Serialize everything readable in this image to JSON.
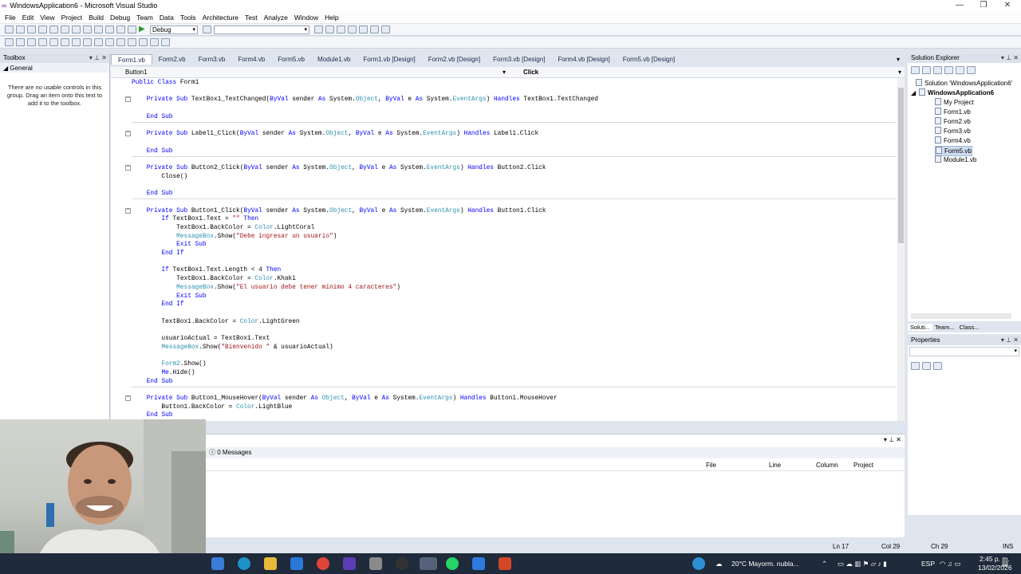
{
  "window": {
    "title": "WindowsApplication6 - Microsoft Visual Studio",
    "minimize": "—",
    "maximize": "❐",
    "close": "✕"
  },
  "menu": [
    "File",
    "Edit",
    "View",
    "Project",
    "Build",
    "Debug",
    "Team",
    "Data",
    "Tools",
    "Architecture",
    "Test",
    "Analyze",
    "Window",
    "Help"
  ],
  "toolbar": {
    "config": "Debug",
    "platform": ""
  },
  "toolbox": {
    "title": "Toolbox",
    "group": "General",
    "empty_message": "There are no usable controls in this group. Drag an item onto this text to add it to the toolbox."
  },
  "editor": {
    "tabs": [
      "Form1.vb",
      "Form2.vb",
      "Form3.vb",
      "Form4.vb",
      "Form5.vb",
      "Module1.vb",
      "Form1.vb [Design]",
      "Form2.vb [Design]",
      "Form3.vb [Design]",
      "Form4.vb [Design]",
      "Form5.vb [Design]"
    ],
    "active_tab": 0,
    "object_dropdown": "Button1",
    "event_dropdown": "Click",
    "lines": [
      "Public Class Form1",
      "",
      "    Private Sub TextBox1_TextChanged(ByVal sender As System.Object, ByVal e As System.EventArgs) Handles TextBox1.TextChanged",
      "",
      "    End Sub",
      "",
      "    Private Sub Label1_Click(ByVal sender As System.Object, ByVal e As System.EventArgs) Handles Label1.Click",
      "",
      "    End Sub",
      "",
      "    Private Sub Button2_Click(ByVal sender As System.Object, ByVal e As System.EventArgs) Handles Button2.Click",
      "        Close()",
      "",
      "    End Sub",
      "",
      "    Private Sub Button1_Click(ByVal sender As System.Object, ByVal e As System.EventArgs) Handles Button1.Click",
      "        If TextBox1.Text = \"\" Then",
      "            TextBox1.BackColor = Color.LightCoral",
      "            MessageBox.Show(\"Debe ingresar un usuario\")",
      "            Exit Sub",
      "        End If",
      "",
      "        If TextBox1.Text.Length < 4 Then",
      "            TextBox1.BackColor = Color.Khaki",
      "            MessageBox.Show(\"El usuario debe tener mínimo 4 caracteres\")",
      "            Exit Sub",
      "        End If",
      "",
      "        TextBox1.BackColor = Color.LightGreen",
      "",
      "        usuarioActual = TextBox1.Text",
      "        MessageBox.Show(\"Bienvenido \" & usuarioActual)",
      "",
      "        Form2.Show()",
      "        Me.Hide()",
      "    End Sub",
      "",
      "    Private Sub Button1_MouseHover(ByVal sender As Object, ByVal e As System.EventArgs) Handles Button1.MouseHover",
      "        Button1.BackColor = Color.LightBlue",
      "    End Sub"
    ]
  },
  "solution_explorer": {
    "title": "Solution Explorer",
    "solution": "Solution 'WindowsApplication6'",
    "project": "WindowsApplication6",
    "items": [
      "My Project",
      "Form1.vb",
      "Form2.vb",
      "Form3.vb",
      "Form4.vb",
      "Form5.vb",
      "Module1.vb"
    ],
    "selected_item": "Form5.vb",
    "tabs": [
      "Soluti...",
      "Team...",
      "Class..."
    ]
  },
  "properties": {
    "title": "Properties"
  },
  "error_list": {
    "messages": "0 Messages",
    "columns": [
      "File",
      "Line",
      "Column",
      "Project"
    ]
  },
  "status": {
    "ln": "Ln 17",
    "col": "Col 29",
    "ch": "Ch 29",
    "mode": "INS"
  },
  "taskbar": {
    "weather": "20°C  Mayorm. nubla...",
    "lang": "ESP",
    "time": "2:45 p. m.",
    "date": "13/02/2026"
  },
  "colors": {
    "keyword": "#0000ff",
    "type": "#2b91af",
    "string": "#a31515",
    "chrome": "#dfe5ee"
  }
}
